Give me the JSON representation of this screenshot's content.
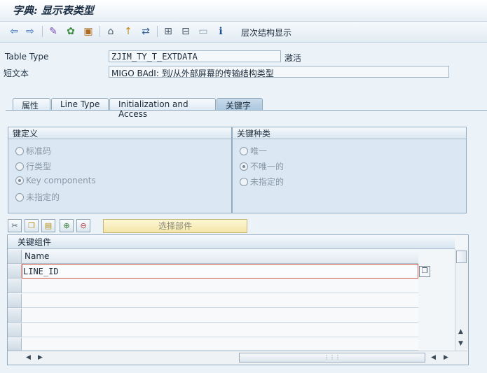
{
  "window": {
    "title": "字典: 显示表类型"
  },
  "toolbar": {
    "hierarchy_label": "层次结构显示"
  },
  "header": {
    "table_type_label": "Table Type",
    "table_type_value": "ZJIM_TY_T_EXTDATA",
    "status": "激活",
    "short_text_label": "短文本",
    "short_text_value": "MIGO BAdI: 到/从外部屏幕的传输结构类型"
  },
  "tabs": [
    {
      "label": "属性"
    },
    {
      "label": "Line Type"
    },
    {
      "label": "Initialization and Access"
    },
    {
      "label": "关键字"
    }
  ],
  "key_definition": {
    "title": "键定义",
    "options": [
      "标准码",
      "行类型",
      "Key components",
      "未指定的"
    ],
    "selected": "Key components"
  },
  "key_category": {
    "title": "关键种类",
    "options": [
      "唯一",
      "不唯一的",
      "未指定的"
    ],
    "selected": "不唯一的"
  },
  "select_components_label": "选择部件",
  "key_components": {
    "title": "关键组件",
    "column_header": "Name",
    "rows": [
      "LINE_ID",
      "",
      "",
      "",
      "",
      ""
    ]
  }
}
